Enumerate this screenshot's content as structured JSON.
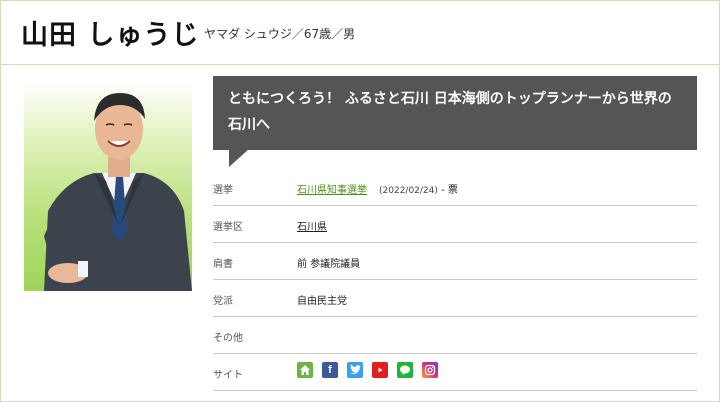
{
  "header": {
    "name": "山田 しゅうじ",
    "reading": "ヤマダ シュウジ／67歳／男"
  },
  "speech": "ともにつくろう！ ふるさと石川 日本海側のトップランナーから世界の石川へ",
  "profile": {
    "election": {
      "label": "選挙",
      "value": "石川県知事選挙",
      "date": "(2022/02/24)",
      "votes": "- 票"
    },
    "district": {
      "label": "選挙区",
      "value": "石川県"
    },
    "title": {
      "label": "肩書",
      "value": "前 参議院議員"
    },
    "party": {
      "label": "党派",
      "value": "自由民主党"
    },
    "other": {
      "label": "その他",
      "value": ""
    },
    "site": {
      "label": "サイト"
    }
  },
  "site_icons": [
    {
      "name": "home-icon",
      "color": "#6fb24a"
    },
    {
      "name": "facebook-icon",
      "color": "#3b5a9a"
    },
    {
      "name": "twitter-icon",
      "color": "#38a1f3"
    },
    {
      "name": "youtube-icon",
      "color": "#e02020"
    },
    {
      "name": "line-icon",
      "color": "#22b33a"
    },
    {
      "name": "instagram-icon",
      "color": "#d6307a"
    }
  ]
}
